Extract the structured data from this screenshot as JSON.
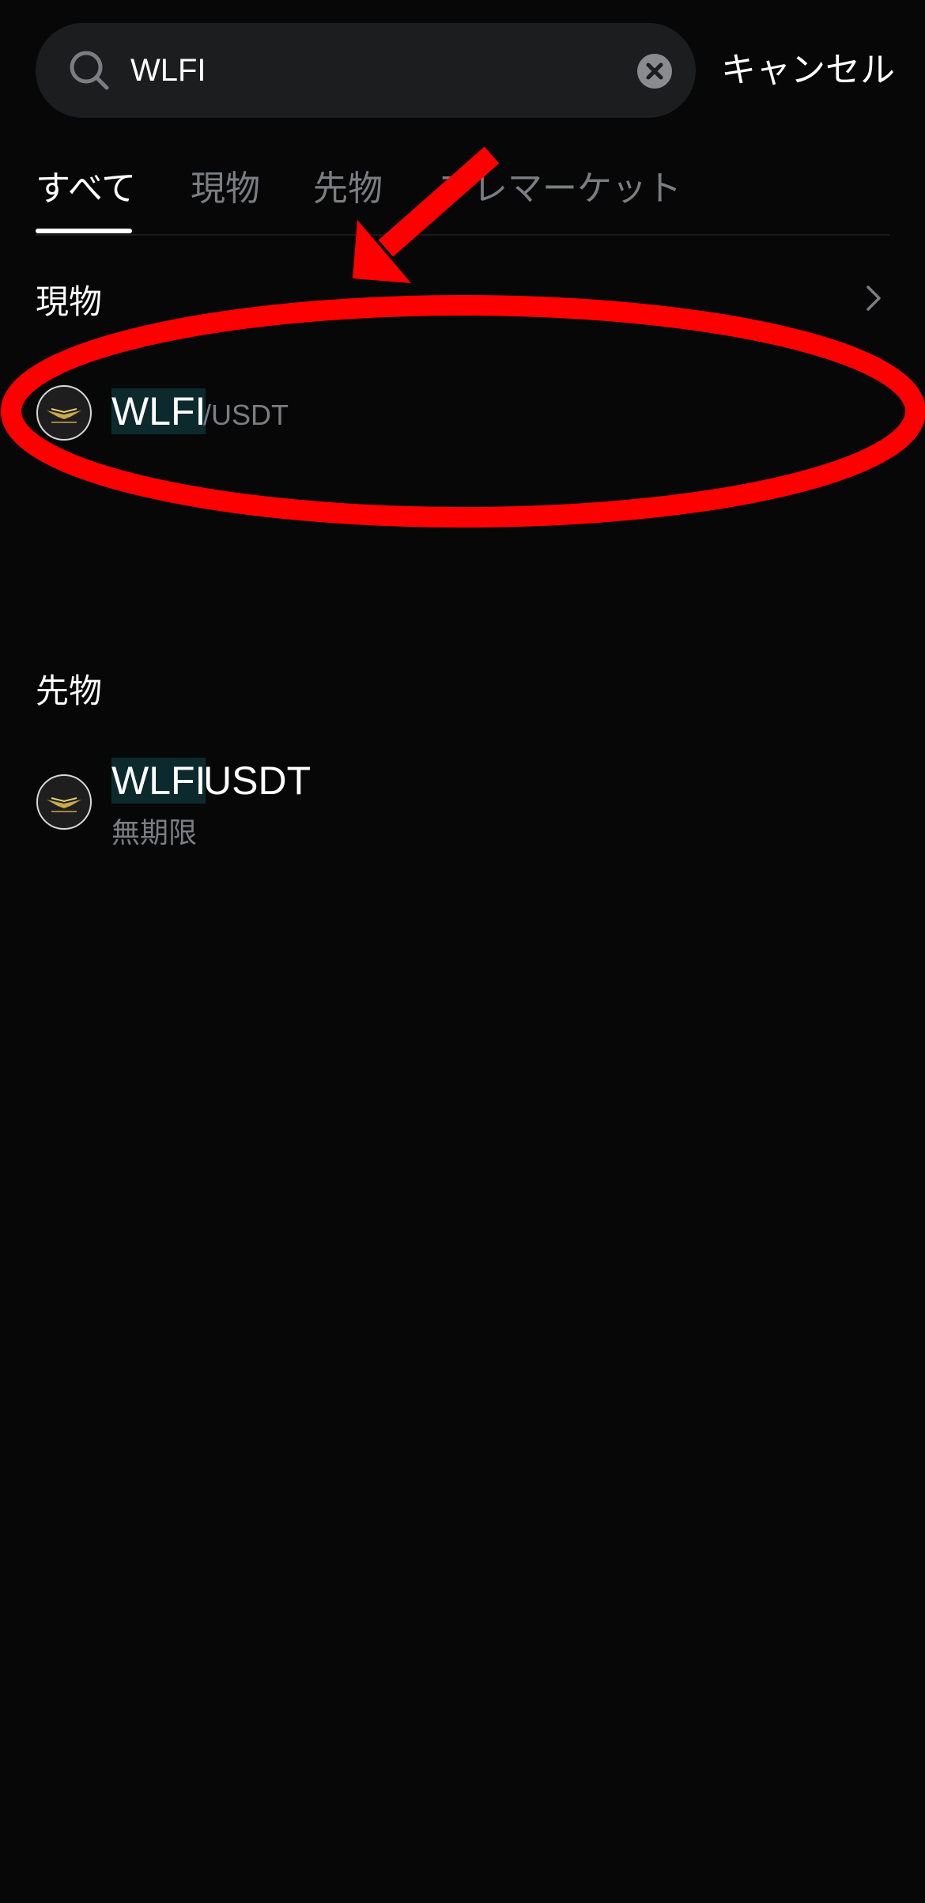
{
  "search": {
    "query": "WLFI",
    "placeholder": "",
    "cancel_label": "キャンセル",
    "search_icon": "search-icon",
    "clear_icon": "clear-icon"
  },
  "tabs": [
    {
      "label": "すべて",
      "active": true
    },
    {
      "label": "現物",
      "active": false
    },
    {
      "label": "先物",
      "active": false
    },
    {
      "label": "プレマーケット",
      "active": false
    }
  ],
  "spot": {
    "title": "現物",
    "items": [
      {
        "base": "WLFI",
        "rest": "/USDT",
        "icon": "wlfi-coin-icon"
      }
    ]
  },
  "futures": {
    "title": "先物",
    "items": [
      {
        "base": "WLFI",
        "rest": "USDT",
        "sub": "無期限",
        "icon": "wlfi-coin-icon"
      }
    ]
  },
  "colors": {
    "background": "#070707",
    "search_bg": "#1c1d1f",
    "highlight": "#0c2a2d",
    "muted": "#7b7d82",
    "annotation": "#ff0000"
  }
}
